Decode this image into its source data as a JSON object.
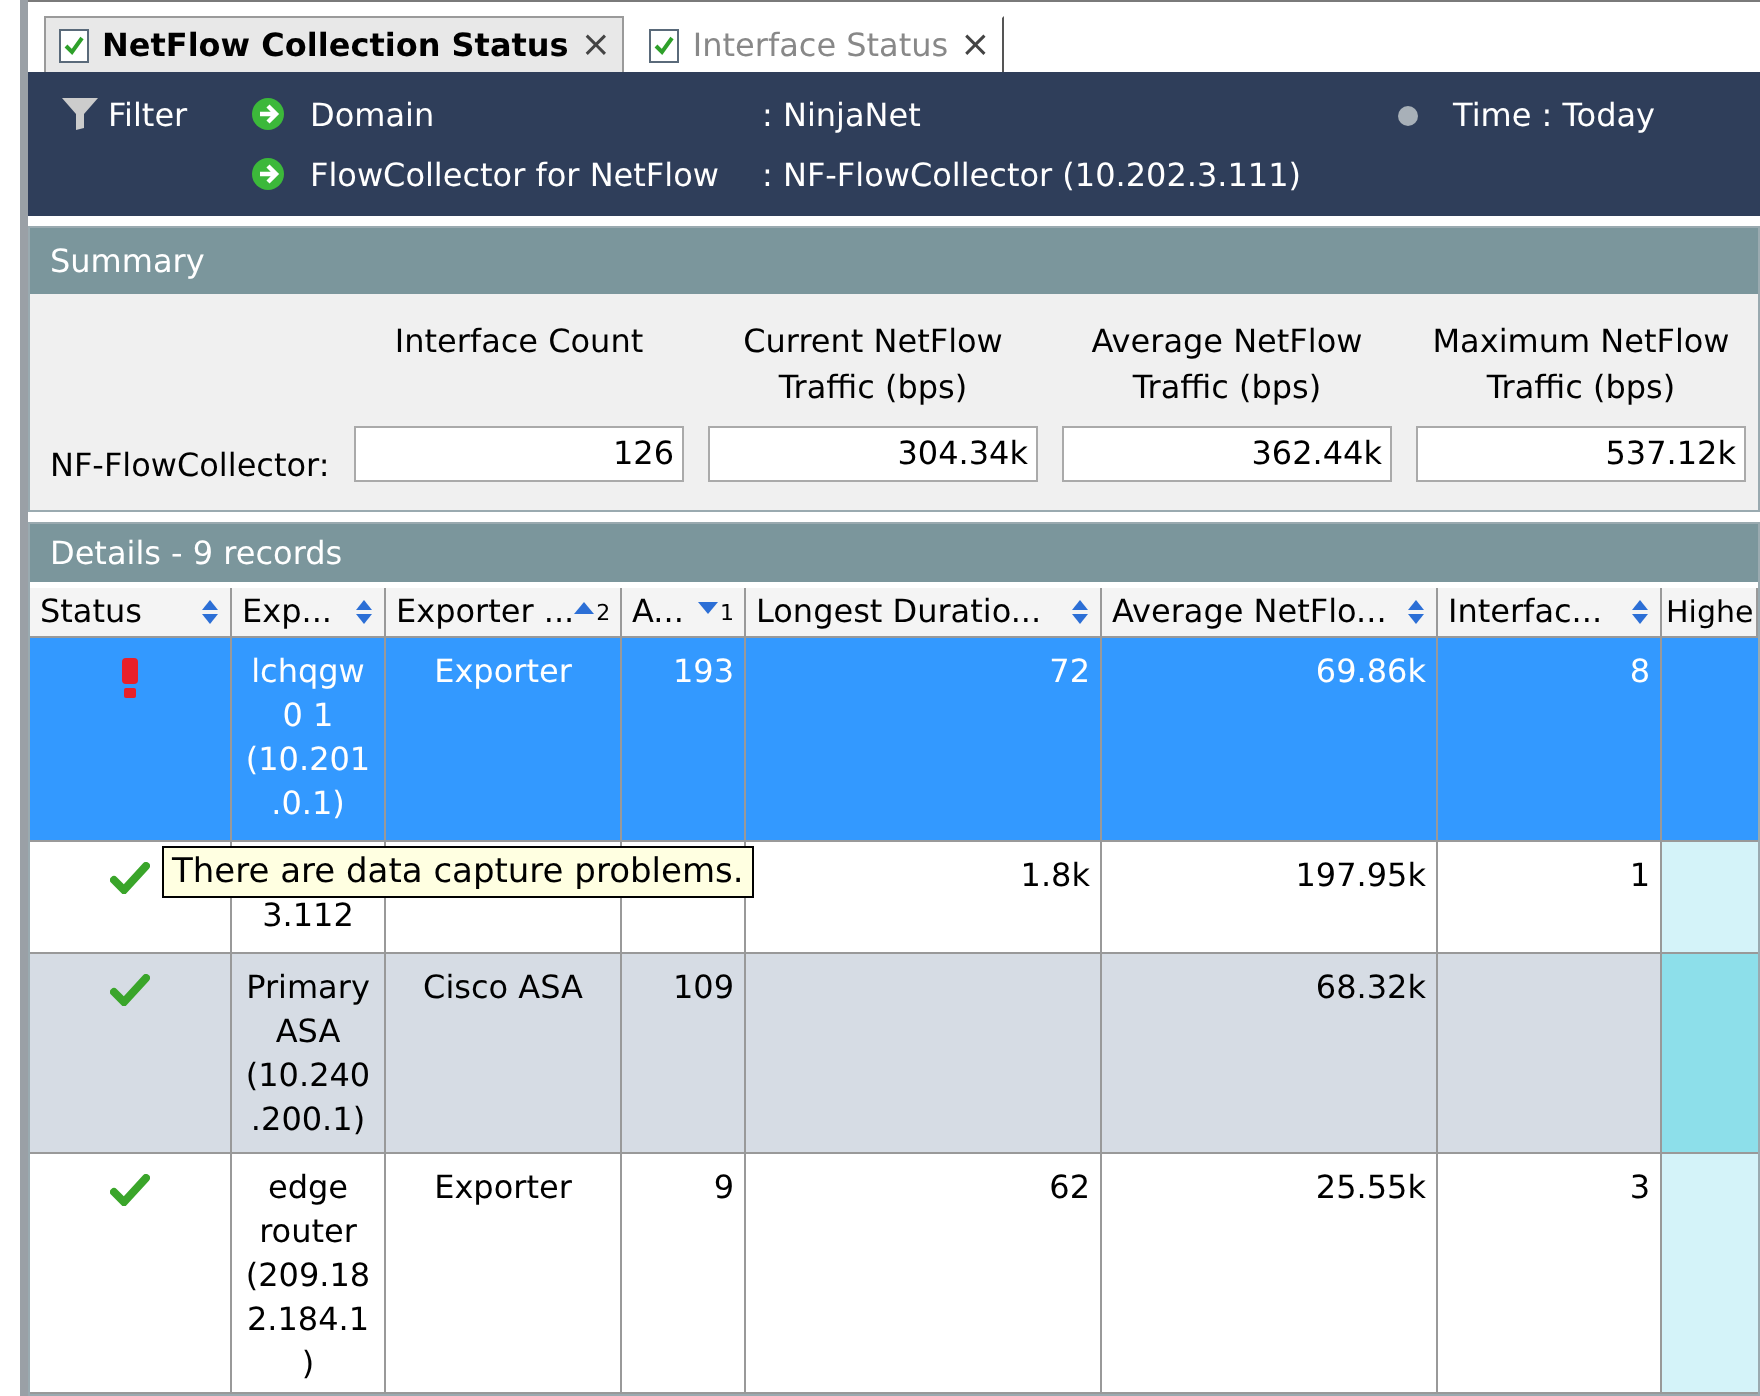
{
  "tabs": [
    {
      "label": "NetFlow Collection Status",
      "selected": true,
      "close": "×"
    },
    {
      "label": "Interface Status",
      "selected": false,
      "close": "×"
    }
  ],
  "filter_bar": {
    "filter": "Filter",
    "rows": [
      {
        "label": "Domain",
        "value": ": NinjaNet"
      },
      {
        "label": "FlowCollector for NetFlow",
        "value": ": NF-FlowCollector (10.202.3.111)"
      }
    ],
    "time": "Time : Today"
  },
  "summary": {
    "title": "Summary",
    "row_label": "NF-FlowCollector:",
    "columns": [
      {
        "heading": "Interface Count",
        "value": "126"
      },
      {
        "heading": "Current NetFlow Traffic (bps)",
        "value": "304.34k"
      },
      {
        "heading": "Average NetFlow Traffic (bps)",
        "value": "362.44k"
      },
      {
        "heading": "Maximum NetFlow Traffic (bps)",
        "value": "537.12k"
      }
    ]
  },
  "details": {
    "title": "Details - 9 records",
    "columns": [
      {
        "label": "Status",
        "kind": "unsorted"
      },
      {
        "label": "Exp...",
        "kind": "unsorted"
      },
      {
        "label": "Exporter ...",
        "kind": "ascending",
        "rank": "2"
      },
      {
        "label": "A...",
        "kind": "descending",
        "rank": "1"
      },
      {
        "label": "Longest Duratio...",
        "kind": "unsorted"
      },
      {
        "label": "Average NetFlo...",
        "kind": "unsorted"
      },
      {
        "label": "Interfac...",
        "kind": "unsorted"
      },
      {
        "label": "Highe",
        "kind": "cut"
      }
    ],
    "rows": [
      {
        "problem": true,
        "selected": true,
        "cells": [
          "",
          "lchqgw0 1 (10.201 .0.1)",
          "Exporter",
          "193",
          "72",
          "69.86k",
          "8",
          ""
        ]
      },
      {
        "problem": false,
        "selected": false,
        "cells": [
          "",
          "3.112",
          "",
          "",
          "1.8k",
          "197.95k",
          "1",
          ""
        ]
      },
      {
        "problem": false,
        "selected": false,
        "cells": [
          "",
          "Primary ASA (10.240 .200.1)",
          "Cisco ASA",
          "109",
          "",
          "68.32k",
          "",
          ""
        ]
      },
      {
        "problem": false,
        "selected": false,
        "cells": [
          "",
          "edge router (209.18 2.184.1 )",
          "Exporter",
          "9",
          "62",
          "25.55k",
          "3",
          ""
        ]
      }
    ],
    "tooltip": "There are data capture problems."
  }
}
